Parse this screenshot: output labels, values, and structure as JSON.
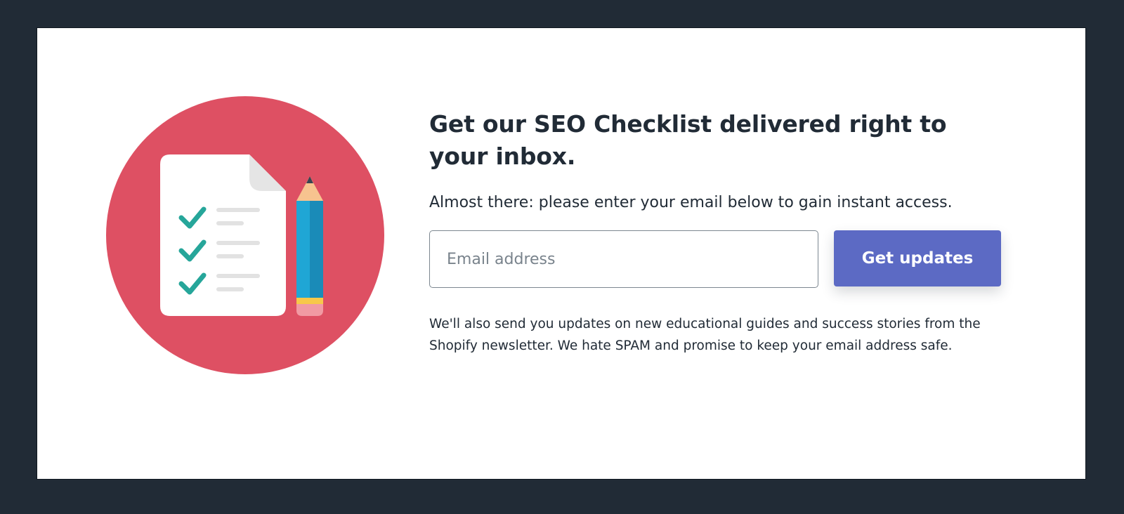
{
  "headline": "Get our SEO Checklist delivered right to your inbox.",
  "subtext": "Almost there: please enter your email below to gain instant access.",
  "email": {
    "placeholder": "Email address",
    "value": ""
  },
  "submit_label": "Get updates",
  "disclaimer": "We'll also send you updates on new educational guides and success stories from the Shopify newsletter. We hate SPAM and promise to keep your email address safe.",
  "illustration": {
    "icons": [
      "checklist-document-icon",
      "check-icon",
      "pencil-icon"
    ]
  },
  "colors": {
    "page_background": "#212b36",
    "card_background": "#ffffff",
    "circle": "#de5063",
    "checkmark": "#26a69a",
    "button": "#5c6ac4",
    "text": "#212b36"
  }
}
